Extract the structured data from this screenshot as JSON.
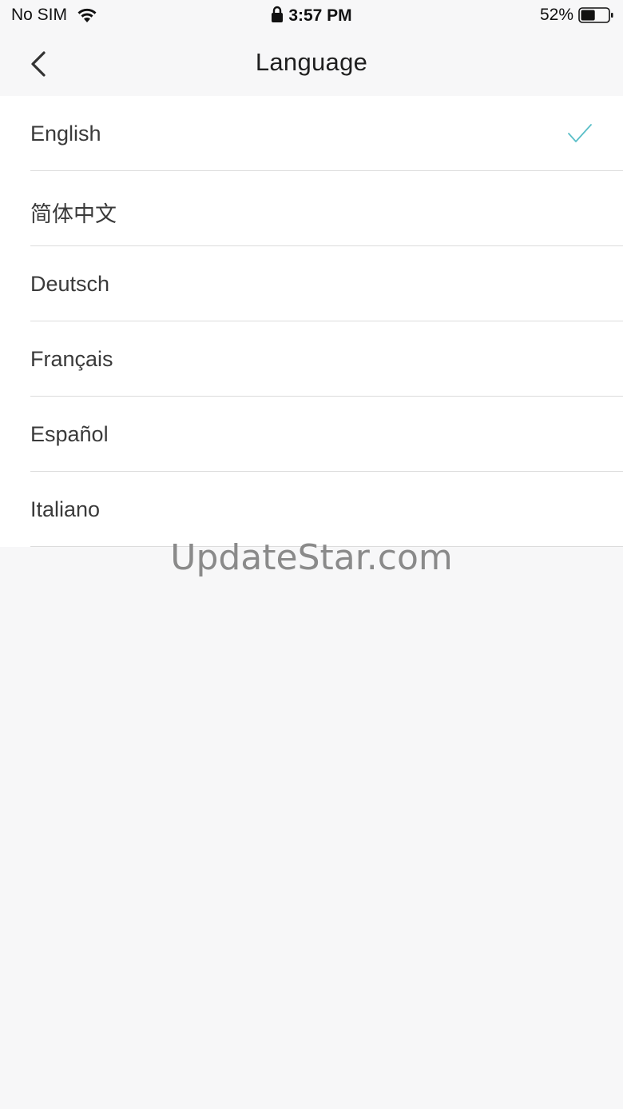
{
  "status_bar": {
    "carrier": "No SIM",
    "time": "3:57 PM",
    "battery_percent": "52%",
    "battery_level": 0.52
  },
  "nav": {
    "title": "Language",
    "back_icon": "chevron-left-icon"
  },
  "languages": [
    {
      "label": "English",
      "selected": true
    },
    {
      "label": "简体中文",
      "selected": false
    },
    {
      "label": "Deutsch",
      "selected": false
    },
    {
      "label": "Français",
      "selected": false
    },
    {
      "label": "Español",
      "selected": false
    },
    {
      "label": "Italiano",
      "selected": false
    }
  ],
  "watermark": "UpdateStar.com",
  "colors": {
    "accent_check": "#5bbfc8",
    "background": "#f7f7f8",
    "list_background": "#ffffff"
  }
}
